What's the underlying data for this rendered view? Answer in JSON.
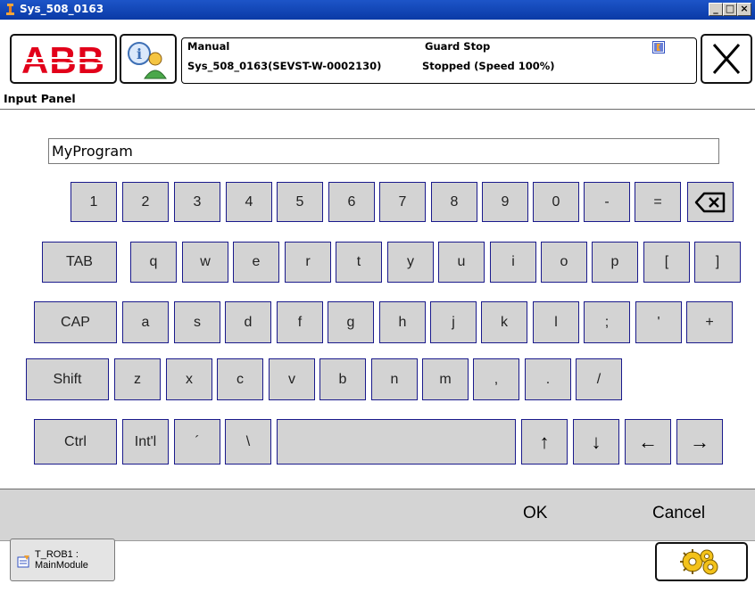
{
  "window": {
    "title": "Sys_508_0163",
    "controls": [
      "_",
      "□",
      "×"
    ]
  },
  "header": {
    "logo_text": "ABB",
    "mode": "Manual",
    "state": "Guard Stop",
    "system": "Sys_508_0163(SEVST-W-0002130)",
    "run_status": "Stopped (Speed 100%)",
    "close_symbol": "×"
  },
  "panel": {
    "title": "Input Panel"
  },
  "input": {
    "value": "MyProgram"
  },
  "keyboard": {
    "row1": [
      "1",
      "2",
      "3",
      "4",
      "5",
      "6",
      "7",
      "8",
      "9",
      "0",
      "-",
      "="
    ],
    "row2": [
      "TAB",
      "q",
      "w",
      "e",
      "r",
      "t",
      "y",
      "u",
      "i",
      "o",
      "p",
      "[",
      "]"
    ],
    "row3": [
      "CAP",
      "a",
      "s",
      "d",
      "f",
      "g",
      "h",
      "j",
      "k",
      "l",
      ";",
      "'",
      "+"
    ],
    "row4": [
      "Shift",
      "z",
      "x",
      "c",
      "v",
      "b",
      "n",
      "m",
      ",",
      ".",
      "/"
    ],
    "row5": [
      "Ctrl",
      "Int'l",
      "´",
      "\\"
    ],
    "arrows": [
      "↑",
      "↓",
      "←",
      "→"
    ]
  },
  "commands": {
    "ok": "OK",
    "cancel": "Cancel"
  },
  "taskbar": {
    "task_line1": "T_ROB1 :",
    "task_line2": "MainModule"
  },
  "colors": {
    "abb_red": "#e2001a",
    "title_blue": "#0a3aa6",
    "key_fill": "#d3d3d3",
    "key_border": "#1a1a8c"
  }
}
